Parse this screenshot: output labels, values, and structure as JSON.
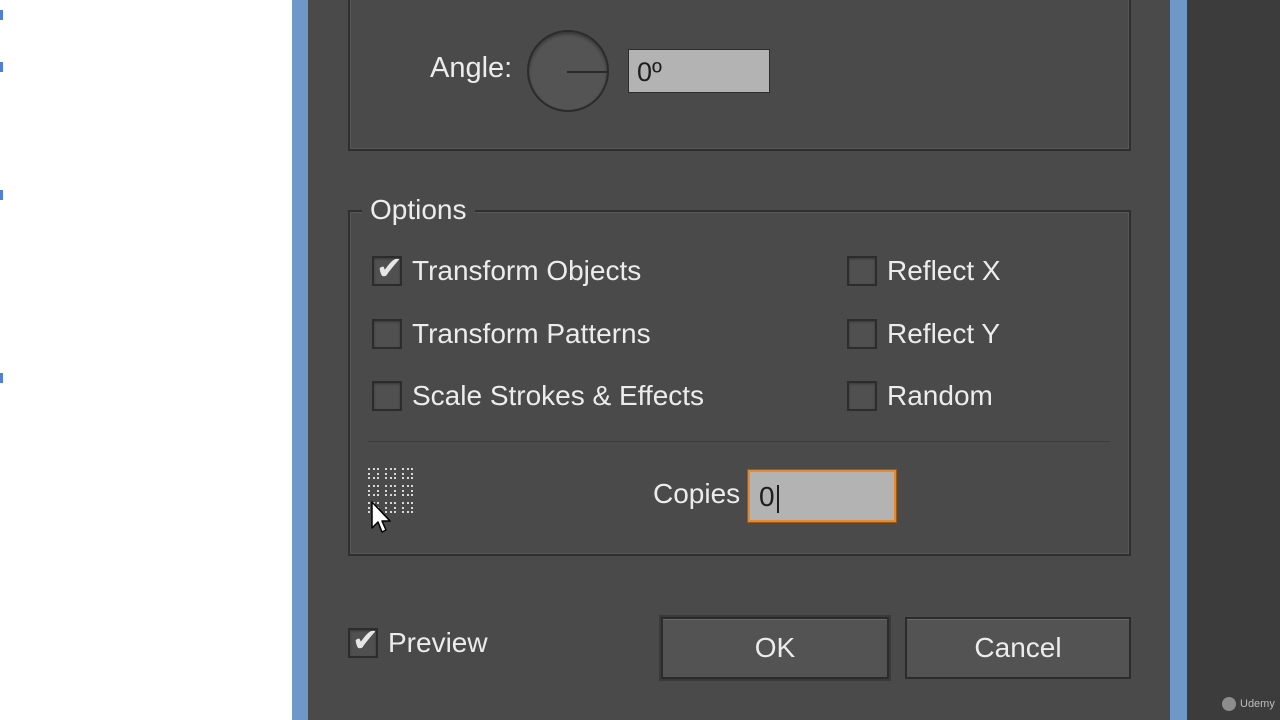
{
  "angle": {
    "label": "Angle:",
    "value": "0º"
  },
  "options": {
    "legend": "Options",
    "transform_objects": {
      "label": "Transform Objects",
      "checked": true
    },
    "transform_patterns": {
      "label": "Transform Patterns",
      "checked": false
    },
    "scale_strokes": {
      "label": "Scale Strokes & Effects",
      "checked": false
    },
    "reflect_x": {
      "label": "Reflect X",
      "checked": false
    },
    "reflect_y": {
      "label": "Reflect Y",
      "checked": false
    },
    "random": {
      "label": "Random",
      "checked": false
    }
  },
  "copies": {
    "label": "Copies",
    "value": "0"
  },
  "preview": {
    "label": "Preview",
    "checked": true
  },
  "buttons": {
    "ok": "OK",
    "cancel": "Cancel"
  },
  "watermark": {
    "text": "Udemy"
  },
  "icons": {
    "reference_point": "reference-point-grid-icon",
    "cursor": "mouse-pointer-icon",
    "check": "checkmark-icon"
  },
  "colors": {
    "dialog_bg": "#4a4a4a",
    "focus_ring": "#e8892d",
    "frame_blue": "#6f97c7"
  }
}
